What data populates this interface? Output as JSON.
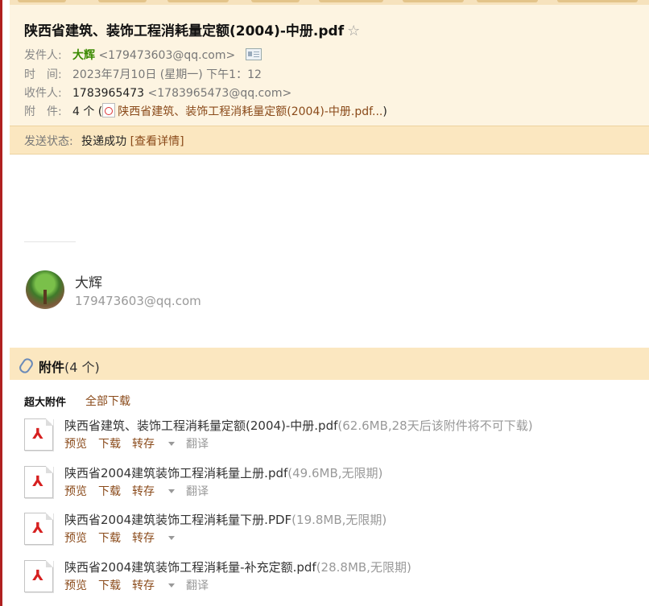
{
  "email": {
    "subject": "陕西省建筑、装饰工程消耗量定额(2004)-中册.pdf",
    "star_glyph": "☆",
    "from_label": "发件人:",
    "from_name": "大辉",
    "from_email": "<179473603@qq.com>",
    "time_label": "时　间:",
    "time_value": "2023年7月10日 (星期一) 下午1：12",
    "to_label": "收件人:",
    "to_name": "1783965473",
    "to_email": "<1783965473@qq.com>",
    "attach_label": "附　件:",
    "attach_count": "4 个 (",
    "attach_link": "陕西省建筑、装饰工程消耗量定额(2004)-中册.pdf...",
    "attach_close": ")"
  },
  "status": {
    "label": "发送状态:",
    "value": "投递成功",
    "detail_link": "[查看详情]"
  },
  "signature": {
    "name": "大辉",
    "email": "179473603@qq.com"
  },
  "attachments": {
    "title": "附件",
    "count": "(4 个)",
    "big_label": "超大附件",
    "download_all": "全部下载",
    "files": [
      {
        "name": "陕西省建筑、装饰工程消耗量定额(2004)-中册.pdf",
        "meta": "(62.6MB,28天后该附件将不可下载)"
      },
      {
        "name": "陕西省2004建筑装饰工程消耗量上册.pdf",
        "meta": "(49.6MB,无限期)"
      },
      {
        "name": "陕西省2004建筑装饰工程消耗量下册.PDF",
        "meta": "(19.8MB,无限期)"
      },
      {
        "name": "陕西省2004建筑装饰工程消耗量-补充定额.pdf",
        "meta": "(28.8MB,无限期)"
      }
    ],
    "actions": {
      "preview": "预览",
      "download": "下载",
      "save": "转存",
      "translate": "翻译"
    }
  },
  "colors": {
    "header_bg": "#fdf4e1",
    "status_bg": "#fbe7c0",
    "link": "#8a4a1a",
    "sender_green": "#3a8a00"
  }
}
